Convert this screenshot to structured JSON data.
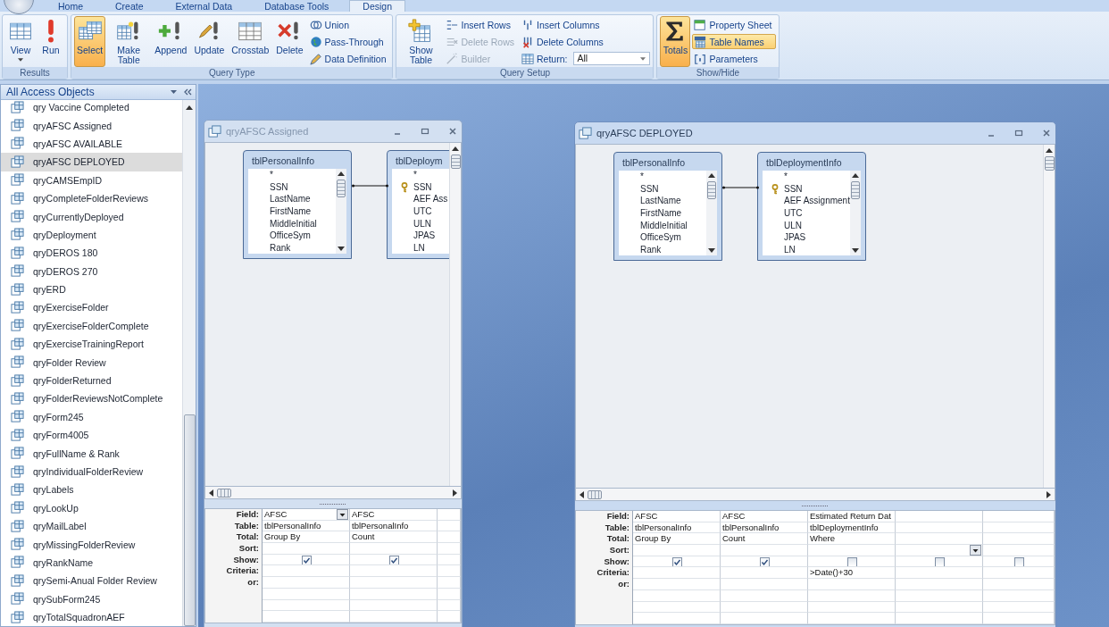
{
  "ribbon": {
    "tabs": [
      {
        "label": "Home",
        "selected": false
      },
      {
        "label": "Create",
        "selected": false
      },
      {
        "label": "External Data",
        "selected": false
      },
      {
        "label": "Database Tools",
        "selected": false
      },
      {
        "label": "Design",
        "selected": true
      }
    ],
    "groups": [
      {
        "label": "Results",
        "buttons": [
          {
            "label": "View",
            "kind": "split",
            "selected": false,
            "disabled": false
          },
          {
            "label": "Run",
            "kind": "large",
            "selected": false,
            "disabled": false
          }
        ]
      },
      {
        "label": "Query Type",
        "buttons": [
          {
            "label": "Select",
            "kind": "large",
            "selected": true,
            "disabled": false
          },
          {
            "label": "Make Table",
            "kind": "large",
            "selected": false,
            "disabled": false
          },
          {
            "label": "Append",
            "kind": "large",
            "selected": false,
            "disabled": false
          },
          {
            "label": "Update",
            "kind": "large",
            "selected": false,
            "disabled": false
          },
          {
            "label": "Crosstab",
            "kind": "large",
            "selected": false,
            "disabled": false
          },
          {
            "label": "Delete",
            "kind": "large",
            "selected": false,
            "disabled": false
          },
          {
            "label": "Union",
            "kind": "small",
            "selected": false,
            "disabled": false
          },
          {
            "label": "Pass-Through",
            "kind": "small",
            "selected": false,
            "disabled": false
          },
          {
            "label": "Data Definition",
            "kind": "small",
            "selected": false,
            "disabled": false
          }
        ]
      },
      {
        "label": "Query Setup",
        "buttons": [
          {
            "label": "Show Table",
            "kind": "large",
            "selected": false,
            "disabled": false
          },
          {
            "label": "Insert Rows",
            "kind": "small",
            "selected": false,
            "disabled": false
          },
          {
            "label": "Delete Rows",
            "kind": "small",
            "selected": false,
            "disabled": true
          },
          {
            "label": "Builder",
            "kind": "small",
            "selected": false,
            "disabled": true
          },
          {
            "label": "Insert Columns",
            "kind": "small",
            "selected": false,
            "disabled": false
          },
          {
            "label": "Delete Columns",
            "kind": "small",
            "selected": false,
            "disabled": false
          },
          {
            "label": "Return:",
            "kind": "combo",
            "value": "All",
            "selected": false,
            "disabled": false
          }
        ]
      },
      {
        "label": "Show/Hide",
        "buttons": [
          {
            "label": "Totals",
            "kind": "large",
            "selected": true,
            "disabled": false
          },
          {
            "label": "Property Sheet",
            "kind": "small",
            "selected": false,
            "disabled": false
          },
          {
            "label": "Table Names",
            "kind": "small",
            "selected": true,
            "disabled": false
          },
          {
            "label": "Parameters",
            "kind": "small",
            "selected": false,
            "disabled": false
          }
        ]
      }
    ]
  },
  "navigation_pane": {
    "title": "All Access Objects",
    "items": [
      {
        "label": "qry Vaccine Completed",
        "selected": false
      },
      {
        "label": "qryAFSC Assigned",
        "selected": false
      },
      {
        "label": "qryAFSC AVAILABLE",
        "selected": false
      },
      {
        "label": "qryAFSC DEPLOYED",
        "selected": true
      },
      {
        "label": "qryCAMSEmpID",
        "selected": false
      },
      {
        "label": "qryCompleteFolderReviews",
        "selected": false
      },
      {
        "label": "qryCurrentlyDeployed",
        "selected": false
      },
      {
        "label": "qryDeployment",
        "selected": false
      },
      {
        "label": "qryDEROS 180",
        "selected": false
      },
      {
        "label": "qryDEROS 270",
        "selected": false
      },
      {
        "label": "qryERD",
        "selected": false
      },
      {
        "label": "qryExerciseFolder",
        "selected": false
      },
      {
        "label": "qryExerciseFolderComplete",
        "selected": false
      },
      {
        "label": "qryExerciseTrainingReport",
        "selected": false
      },
      {
        "label": "qryFolder Review",
        "selected": false
      },
      {
        "label": "qryFolderReturned",
        "selected": false
      },
      {
        "label": "qryFolderReviewsNotComplete",
        "selected": false
      },
      {
        "label": "qryForm245",
        "selected": false
      },
      {
        "label": "qryForm4005",
        "selected": false
      },
      {
        "label": "qryFullName & Rank",
        "selected": false
      },
      {
        "label": "qryIndividualFolderReview",
        "selected": false
      },
      {
        "label": "qryLabels",
        "selected": false
      },
      {
        "label": "qryLookUp",
        "selected": false
      },
      {
        "label": "qryMailLabel",
        "selected": false
      },
      {
        "label": "qryMissingFolderReview",
        "selected": false
      },
      {
        "label": "qryRankName",
        "selected": false
      },
      {
        "label": "qrySemi-Anual Folder Review",
        "selected": false
      },
      {
        "label": "qrySubForm245",
        "selected": false
      },
      {
        "label": "qryTotalSquadronAEF",
        "selected": false
      }
    ]
  },
  "query_windows": [
    {
      "title": "qryAFSC Assigned",
      "active": false,
      "tables": [
        {
          "name": "tblPersonalInfo",
          "fields": [
            {
              "name": "*",
              "key": false
            },
            {
              "name": "SSN",
              "key": false
            },
            {
              "name": "LastName",
              "key": false
            },
            {
              "name": "FirstName",
              "key": false
            },
            {
              "name": "MiddleInitial",
              "key": false
            },
            {
              "name": "OfficeSym",
              "key": false
            },
            {
              "name": "Rank",
              "key": false
            }
          ]
        },
        {
          "name": "tblDeploym",
          "fields": [
            {
              "name": "*",
              "key": false
            },
            {
              "name": "SSN",
              "key": true
            },
            {
              "name": "AEF Ass",
              "key": false
            },
            {
              "name": "UTC",
              "key": false
            },
            {
              "name": "ULN",
              "key": false
            },
            {
              "name": "JPAS",
              "key": false
            },
            {
              "name": "LN",
              "key": false
            }
          ]
        }
      ],
      "grid": {
        "row_labels": [
          "Field:",
          "Table:",
          "Total:",
          "Sort:",
          "Show:",
          "Criteria:",
          "or:"
        ],
        "columns": [
          {
            "field": "AFSC",
            "table": "tblPersonalInfo",
            "total": "Group By",
            "show": true,
            "field_dropdown": true,
            "sort_dropdown": false
          },
          {
            "field": "AFSC",
            "table": "tblPersonalInfo",
            "total": "Count",
            "show": true,
            "field_dropdown": false,
            "sort_dropdown": false
          }
        ]
      }
    },
    {
      "title": "qryAFSC DEPLOYED",
      "active": true,
      "tables": [
        {
          "name": "tblPersonalInfo",
          "fields": [
            {
              "name": "*",
              "key": false
            },
            {
              "name": "SSN",
              "key": false
            },
            {
              "name": "LastName",
              "key": false
            },
            {
              "name": "FirstName",
              "key": false
            },
            {
              "name": "MiddleInitial",
              "key": false
            },
            {
              "name": "OfficeSym",
              "key": false
            },
            {
              "name": "Rank",
              "key": false
            }
          ]
        },
        {
          "name": "tblDeploymentInfo",
          "fields": [
            {
              "name": "*",
              "key": false
            },
            {
              "name": "SSN",
              "key": true
            },
            {
              "name": "AEF Assignment",
              "key": false
            },
            {
              "name": "UTC",
              "key": false
            },
            {
              "name": "ULN",
              "key": false
            },
            {
              "name": "JPAS",
              "key": false
            },
            {
              "name": "LN",
              "key": false
            }
          ]
        }
      ],
      "grid": {
        "row_labels": [
          "Field:",
          "Table:",
          "Total:",
          "Sort:",
          "Show:",
          "Criteria:",
          "or:"
        ],
        "columns": [
          {
            "field": "AFSC",
            "table": "tblPersonalInfo",
            "total": "Group By",
            "show": true,
            "field_dropdown": false,
            "sort_dropdown": false
          },
          {
            "field": "AFSC",
            "table": "tblPersonalInfo",
            "total": "Count",
            "show": true,
            "field_dropdown": false,
            "sort_dropdown": false
          },
          {
            "field": "Estimated Return Dat",
            "table": "tblDeploymentInfo",
            "total": "Where",
            "show": false,
            "criteria": ">Date()+30",
            "field_dropdown": false,
            "sort_dropdown": false
          },
          {
            "show": false,
            "field_dropdown": false,
            "sort_dropdown": true
          },
          {
            "show": false,
            "field_dropdown": false,
            "sort_dropdown": false
          }
        ]
      }
    }
  ]
}
